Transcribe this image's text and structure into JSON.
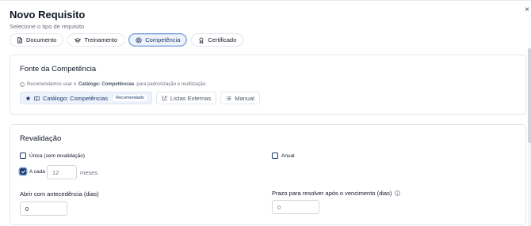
{
  "dialog": {
    "title": "Novo Requisito",
    "subtitle": "Selecione o tipo de requisito",
    "close_label": "×"
  },
  "type_tabs": [
    {
      "label": "Documento",
      "icon": "document-icon",
      "active": false
    },
    {
      "label": "Treinamento",
      "icon": "graduation-cap-icon",
      "active": false
    },
    {
      "label": "Competência",
      "icon": "target-icon",
      "active": true
    },
    {
      "label": "Certificado",
      "icon": "award-icon",
      "active": false
    }
  ],
  "source": {
    "title": "Fonte da Competência",
    "hint_prefix": "Recomendamos usar o",
    "hint_bold": "Catálogo: Competências",
    "hint_suffix": "para padronização e reutilização.",
    "buttons": {
      "catalog": "Catálogo: Competências",
      "catalog_badge": "Recomendado",
      "external": "Listas Externas",
      "manual": "Manual"
    }
  },
  "revalidation": {
    "title": "Revalidação",
    "option_unique": "Única (sem revalidação)",
    "option_annual": "Anual",
    "option_every": "A cada",
    "every_value": "12",
    "every_unit": "meses",
    "advance_label": "Abrir com antecedência (dias)",
    "advance_value": "0",
    "deadline_label": "Prazo para resolver após o vencimento (dias)",
    "deadline_placeholder": "0",
    "checked": {
      "unique": false,
      "annual": false,
      "every": true
    }
  },
  "colors": {
    "accent": "#1e3a6e",
    "accent_light": "#eef3fb"
  }
}
